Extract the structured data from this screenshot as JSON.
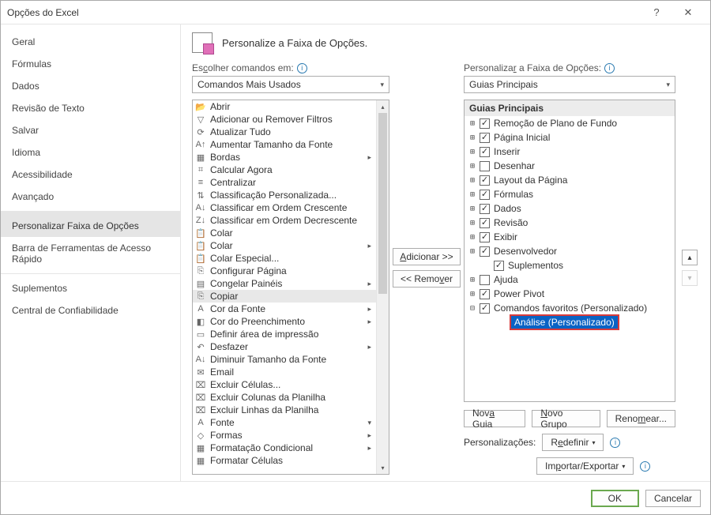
{
  "window": {
    "title": "Opções do Excel"
  },
  "sidebar": {
    "items": [
      {
        "label": "Geral"
      },
      {
        "label": "Fórmulas"
      },
      {
        "label": "Dados"
      },
      {
        "label": "Revisão de Texto"
      },
      {
        "label": "Salvar"
      },
      {
        "label": "Idioma"
      },
      {
        "label": "Acessibilidade"
      },
      {
        "label": "Avançado"
      },
      {
        "label": "Personalizar Faixa de Opções",
        "selected": true
      },
      {
        "label": "Barra de Ferramentas de Acesso Rápido"
      },
      {
        "label": "Suplementos"
      },
      {
        "label": "Central de Confiabilidade"
      }
    ]
  },
  "header": {
    "title": "Personalize a Faixa de Opções."
  },
  "left_panel": {
    "label": "Escolher comandos em:",
    "combo_value": "Comandos Mais Usados",
    "commands": [
      {
        "icon": "folder-open",
        "label": "Abrir"
      },
      {
        "icon": "funnel",
        "label": "Adicionar ou Remover Filtros"
      },
      {
        "icon": "refresh",
        "label": "Atualizar Tudo"
      },
      {
        "icon": "font-inc",
        "label": "Aumentar Tamanho da Fonte"
      },
      {
        "icon": "borders",
        "label": "Bordas",
        "submenu": true
      },
      {
        "icon": "calc",
        "label": "Calcular Agora"
      },
      {
        "icon": "center",
        "label": "Centralizar"
      },
      {
        "icon": "sort-custom",
        "label": "Classificação Personalizada..."
      },
      {
        "icon": "sort-asc",
        "label": "Classificar em Ordem Crescente"
      },
      {
        "icon": "sort-desc",
        "label": "Classificar em Ordem Decrescente"
      },
      {
        "icon": "paste",
        "label": "Colar"
      },
      {
        "icon": "paste",
        "label": "Colar",
        "submenu": true
      },
      {
        "icon": "paste-special",
        "label": "Colar Especial..."
      },
      {
        "icon": "page-setup",
        "label": "Configurar Página"
      },
      {
        "icon": "freeze",
        "label": "Congelar Painéis",
        "submenu": true
      },
      {
        "icon": "copy",
        "label": "Copiar",
        "selected": true
      },
      {
        "icon": "font-color",
        "label": "Cor da Fonte",
        "submenu": true
      },
      {
        "icon": "fill-color",
        "label": "Cor do Preenchimento",
        "submenu": true
      },
      {
        "icon": "print-area",
        "label": "Definir área de impressão"
      },
      {
        "icon": "undo",
        "label": "Desfazer",
        "submenu": true
      },
      {
        "icon": "font-dec",
        "label": "Diminuir Tamanho da Fonte"
      },
      {
        "icon": "email",
        "label": "Email"
      },
      {
        "icon": "del-cells",
        "label": "Excluir Células..."
      },
      {
        "icon": "del-cols",
        "label": "Excluir Colunas da Planilha"
      },
      {
        "icon": "del-rows",
        "label": "Excluir Linhas da Planilha"
      },
      {
        "icon": "font",
        "label": "Fonte",
        "field": true
      },
      {
        "icon": "shapes",
        "label": "Formas",
        "submenu": true
      },
      {
        "icon": "cond-fmt",
        "label": "Formatação Condicional",
        "submenu": true
      },
      {
        "icon": "fmt-cells",
        "label": "Formatar Células"
      }
    ]
  },
  "mid": {
    "add": "Adicionar >>",
    "remove": "<< Remover"
  },
  "right_panel": {
    "label": "Personalizar a Faixa de Opções:",
    "combo_value": "Guias Principais",
    "tree_header": "Guias Principais",
    "nodes": [
      {
        "depth": 1,
        "exp": "⊞",
        "checked": true,
        "label": "Remoção de Plano de Fundo"
      },
      {
        "depth": 1,
        "exp": "⊞",
        "checked": true,
        "label": "Página Inicial"
      },
      {
        "depth": 1,
        "exp": "⊞",
        "checked": true,
        "label": "Inserir"
      },
      {
        "depth": 1,
        "exp": "⊞",
        "checked": false,
        "label": "Desenhar"
      },
      {
        "depth": 1,
        "exp": "⊞",
        "checked": true,
        "label": "Layout da Página"
      },
      {
        "depth": 1,
        "exp": "⊞",
        "checked": true,
        "label": "Fórmulas"
      },
      {
        "depth": 1,
        "exp": "⊞",
        "checked": true,
        "label": "Dados"
      },
      {
        "depth": 1,
        "exp": "⊞",
        "checked": true,
        "label": "Revisão"
      },
      {
        "depth": 1,
        "exp": "⊞",
        "checked": true,
        "label": "Exibir"
      },
      {
        "depth": 1,
        "exp": "⊞",
        "checked": true,
        "label": "Desenvolvedor"
      },
      {
        "depth": 2,
        "exp": "",
        "checked": true,
        "label": "Suplementos"
      },
      {
        "depth": 1,
        "exp": "⊞",
        "checked": false,
        "label": "Ajuda"
      },
      {
        "depth": 1,
        "exp": "⊞",
        "checked": true,
        "label": "Power Pivot"
      },
      {
        "depth": 1,
        "exp": "⊟",
        "checked": true,
        "label": "Comandos favoritos (Personalizado)"
      },
      {
        "depth": 3,
        "exp": "",
        "checked": null,
        "label": "Análise (Personalizado)",
        "highlight": true
      }
    ],
    "buttons": {
      "new_tab": "Nova Guia",
      "new_group": "Novo Grupo",
      "rename": "Renomear..."
    },
    "customizations_label": "Personalizações:",
    "reset": "Redefinir",
    "import_export": "Importar/Exportar"
  },
  "footer": {
    "ok": "OK",
    "cancel": "Cancelar"
  }
}
